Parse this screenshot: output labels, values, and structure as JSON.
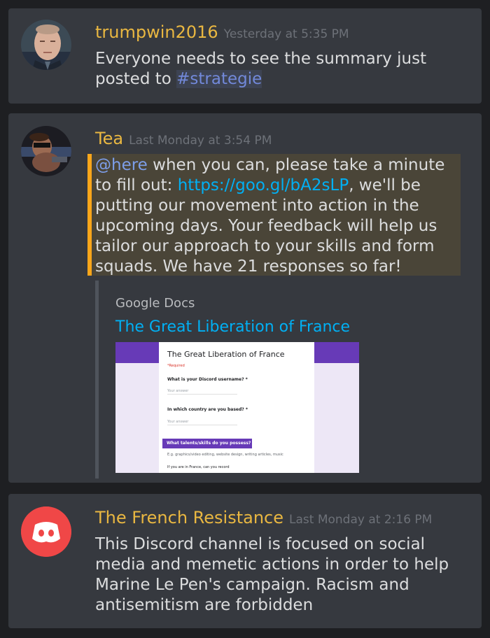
{
  "messages": [
    {
      "username": "trumpwin2016",
      "username_color": "#e9b741",
      "timestamp": "Yesterday at 5:35 PM",
      "text_before": "Everyone needs to see the summary just posted to ",
      "channel": "#strategie"
    },
    {
      "username": "Tea",
      "username_color": "#e9b741",
      "timestamp": "Last Monday at 3:54 PM",
      "mention": "@here",
      "text_1": " when you can, please take a minute to fill out: ",
      "link": "https://goo.gl/bA2sLP",
      "text_2": ", we'll be putting our movement into action in the upcoming days. Your feedback will help us tailor our approach to your skills and form squads. We have 21 responses so far!",
      "embed": {
        "provider": "Google Docs",
        "title": "The Great Liberation of France",
        "form": {
          "title": "The Great Liberation of France",
          "required": "*Required",
          "q1": "What is your Discord username? *",
          "q1_answer": "Your answer",
          "q2": "In which country are you based? *",
          "q2_answer": "Your answer",
          "section": "What talents/skills do you possess?",
          "hint": "E.g. graphics/video editing, website design, writing articles, music",
          "q3": "If you are in France, can you record"
        }
      }
    },
    {
      "username": "The French Resistance",
      "username_color": "#e9b741",
      "timestamp": "Last Monday at 2:16 PM",
      "text": "This Discord channel is focused on social media and memetic actions in order to help Marine Le Pen's campaign. Racism and antisemitism are forbidden",
      "avatar_icon": "discord-logo-icon"
    }
  ]
}
